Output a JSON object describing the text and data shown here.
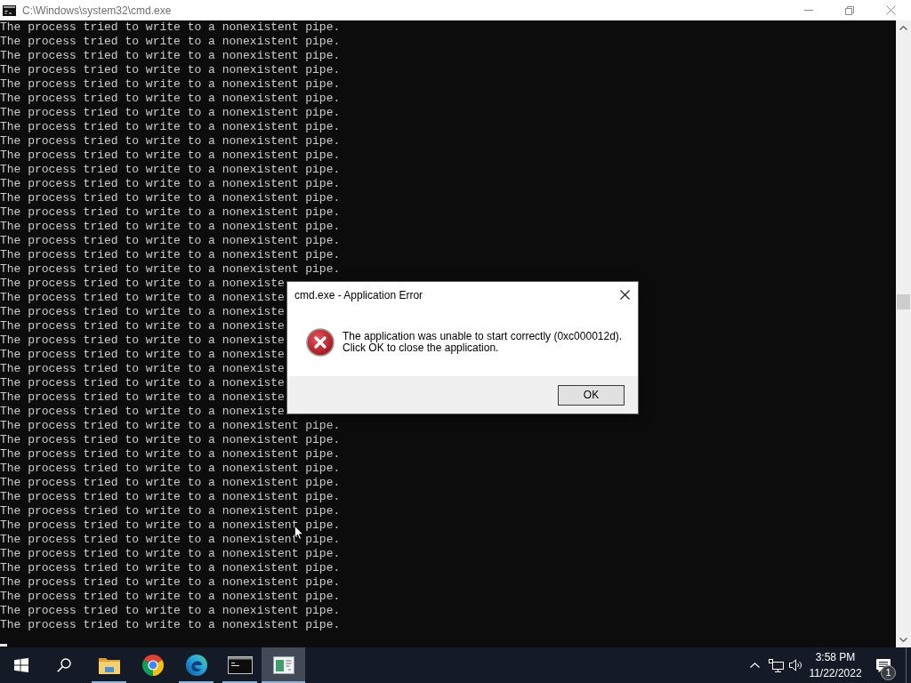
{
  "window": {
    "title": "C:\\Windows\\system32\\cmd.exe"
  },
  "console": {
    "lines": [
      "The process tried to write to a nonexistent pipe.",
      "The process tried to write to a nonexistent pipe.",
      "The process tried to write to a nonexistent pipe.",
      "The process tried to write to a nonexistent pipe.",
      "The process tried to write to a nonexistent pipe.",
      "The process tried to write to a nonexistent pipe.",
      "The process tried to write to a nonexistent pipe.",
      "The process tried to write to a nonexistent pipe.",
      "The process tried to write to a nonexistent pipe.",
      "The process tried to write to a nonexistent pipe.",
      "The process tried to write to a nonexistent pipe.",
      "The process tried to write to a nonexistent pipe.",
      "The process tried to write to a nonexistent pipe.",
      "The process tried to write to a nonexistent pipe.",
      "The process tried to write to a nonexistent pipe.",
      "The process tried to write to a nonexistent pipe.",
      "The process tried to write to a nonexistent pipe.",
      "The process tried to write to a nonexistent pipe.",
      "The process tried to write to a nonexiste",
      "The process tried to write to a nonexiste",
      "The process tried to write to a nonexiste",
      "The process tried to write to a nonexiste",
      "The process tried to write to a nonexiste",
      "The process tried to write to a nonexiste",
      "The process tried to write to a nonexiste",
      "The process tried to write to a nonexiste",
      "The process tried to write to a nonexiste",
      "The process tried to write to a nonexiste",
      "The process tried to write to a nonexistent pipe.",
      "The process tried to write to a nonexistent pipe.",
      "The process tried to write to a nonexistent pipe.",
      "The process tried to write to a nonexistent pipe.",
      "The process tried to write to a nonexistent pipe.",
      "The process tried to write to a nonexistent pipe.",
      "The process tried to write to a nonexistent pipe.",
      "The process tried to write to a nonexistent pipe.",
      "The process tried to write to a nonexistent pipe.",
      "The process tried to write to a nonexistent pipe.",
      "The process tried to write to a nonexistent pipe.",
      "The process tried to write to a nonexistent pipe.",
      "The process tried to write to a nonexistent pipe.",
      "The process tried to write to a nonexistent pipe.",
      "The process tried to write to a nonexistent pipe."
    ]
  },
  "dialog": {
    "title": "cmd.exe - Application Error",
    "message": "The application was unable to start correctly (0xc000012d).\nClick OK to close the application.",
    "buttons": [
      {
        "label": "OK",
        "default": true
      }
    ]
  },
  "taskbar": {
    "apps": [
      {
        "kind": "folder",
        "running": true,
        "selected": false
      },
      {
        "kind": "chrome",
        "running": false,
        "selected": false
      },
      {
        "kind": "edge",
        "running": true,
        "selected": false
      },
      {
        "kind": "terminal",
        "running": true,
        "selected": false
      },
      {
        "kind": "window",
        "running": true,
        "selected": true
      }
    ],
    "clock": {
      "time": "3:58 PM",
      "date": "11/22/2022"
    },
    "notification_count": "1"
  }
}
